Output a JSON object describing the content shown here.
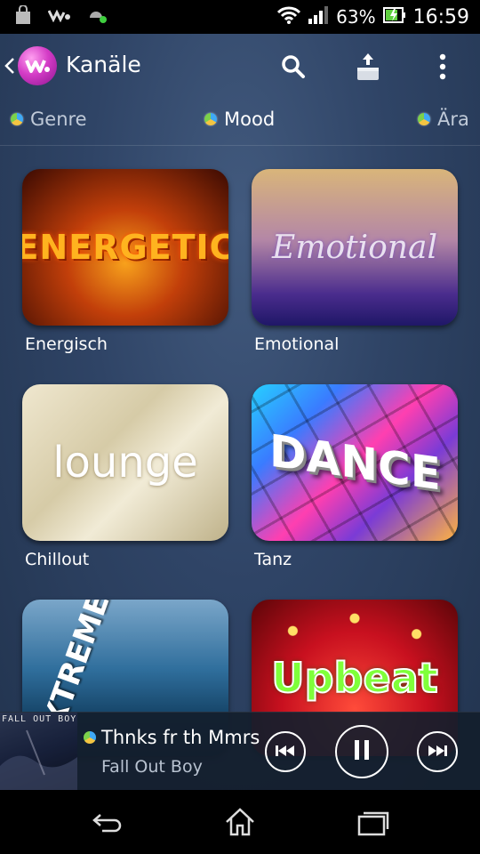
{
  "status_bar": {
    "battery_percent": "63%",
    "time": "16:59"
  },
  "action_bar": {
    "title": "Kanäle",
    "icons": [
      "back-chevron-icon",
      "walkman-logo",
      "search-icon",
      "upload-icon",
      "overflow-menu-icon"
    ]
  },
  "tabs": [
    {
      "label": "Genre",
      "selected": false
    },
    {
      "label": "Mood",
      "selected": true
    },
    {
      "label": "Ära",
      "selected": false
    }
  ],
  "channels": [
    {
      "label": "Energisch",
      "art_text": "ENERGETIC"
    },
    {
      "label": "Emotional",
      "art_text": "Emotional"
    },
    {
      "label": "Chillout",
      "art_text": "lounge"
    },
    {
      "label": "Tanz",
      "art_text": "DANCE"
    },
    {
      "label": "",
      "art_text": "XTREME"
    },
    {
      "label": "",
      "art_text": "Upbeat"
    }
  ],
  "player": {
    "album_text": "FALL OUT BOY",
    "track": "Thnks fr th Mmrs",
    "artist": "Fall Out Boy",
    "state": "playing"
  },
  "nav_bar": {
    "icons": [
      "back-icon",
      "home-icon",
      "recent-apps-icon"
    ]
  }
}
